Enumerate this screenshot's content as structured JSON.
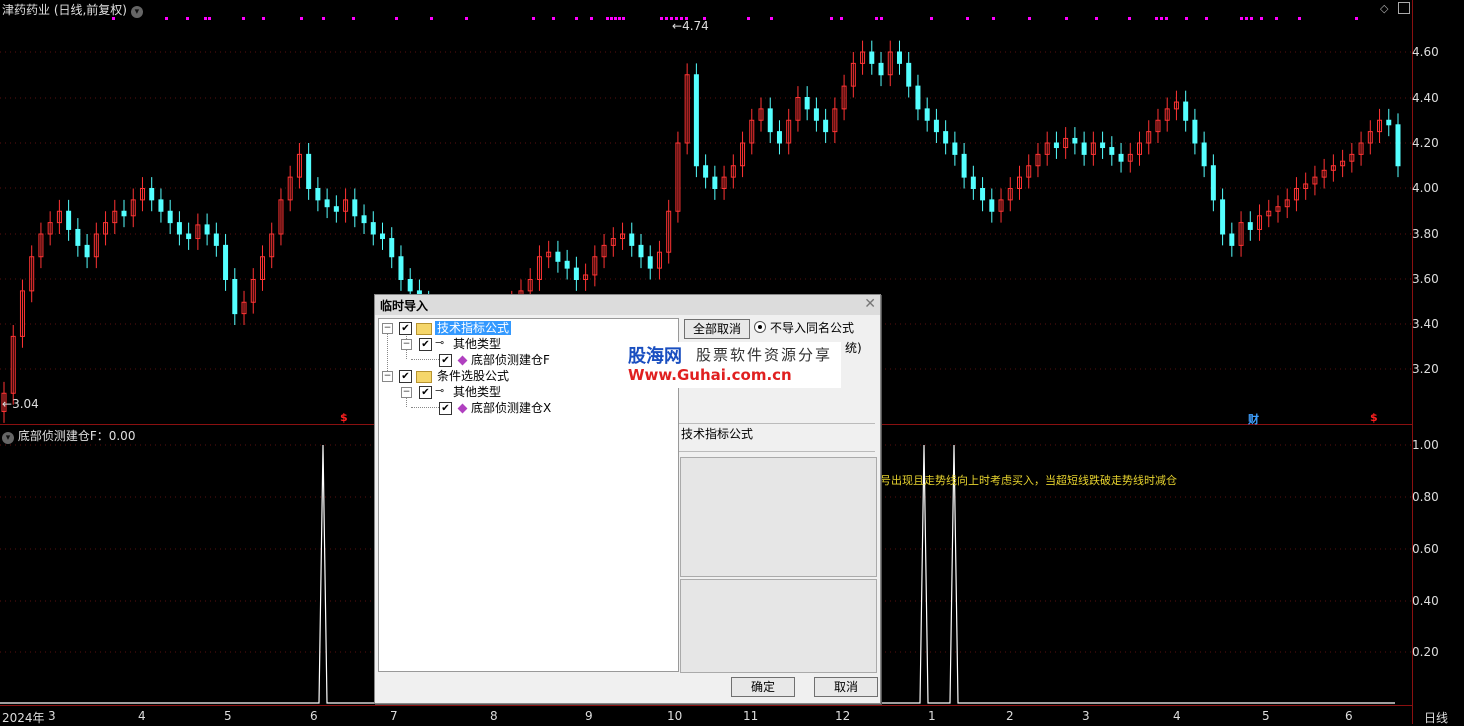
{
  "header": {
    "title": "津药药业 (日线,前复权)",
    "high_label": "4.74",
    "low_label": "3.04"
  },
  "price_axis": [
    "4.60",
    "4.40",
    "4.20",
    "4.00",
    "3.80",
    "3.60",
    "3.40",
    "3.20"
  ],
  "indicator_axis": [
    "1.00",
    "0.80",
    "0.60",
    "0.40",
    "0.20"
  ],
  "x_axis": {
    "year": "2024年",
    "months": [
      "3",
      "4",
      "5",
      "6",
      "7",
      "8",
      "9",
      "10",
      "11",
      "12",
      "1",
      "2",
      "3",
      "4",
      "5",
      "6"
    ],
    "period": "日线"
  },
  "markers": [
    {
      "text": "$",
      "color": "#ff2020"
    },
    {
      "text": "财",
      "color": "#3fa0ff"
    },
    {
      "text": "$",
      "color": "#ff2020"
    }
  ],
  "indicator": {
    "title": "底部侦测建仓F：0.00",
    "note": "号出现且走势线向上时考虑买入，当超短线跌破走势线时减仓"
  },
  "dialog": {
    "title": "临时导入",
    "tree": [
      {
        "label": "技术指标公式",
        "children": [
          {
            "label": "其他类型",
            "children": [
              {
                "label": "底部侦测建仓F"
              }
            ]
          }
        ]
      },
      {
        "label": "条件选股公式",
        "children": [
          {
            "label": "其他类型",
            "children": [
              {
                "label": "底部侦测建仓X"
              }
            ]
          }
        ]
      }
    ],
    "cancel_all": "全部取消",
    "radio_label": "不导入同名公式",
    "radio_label_tail": "统)",
    "section_label": "技术指标公式",
    "ok": "确定",
    "cancel": "取消"
  },
  "watermark": {
    "logo": "股海网",
    "tag": "股票软件资源分享",
    "url": "Www.Guhai.com.cn"
  },
  "colors": {
    "up": "#ff3333",
    "down": "#54ffff",
    "signal": "#ff00ff",
    "indicator_line": "#ffffff",
    "note": "#e6d22e"
  }
}
